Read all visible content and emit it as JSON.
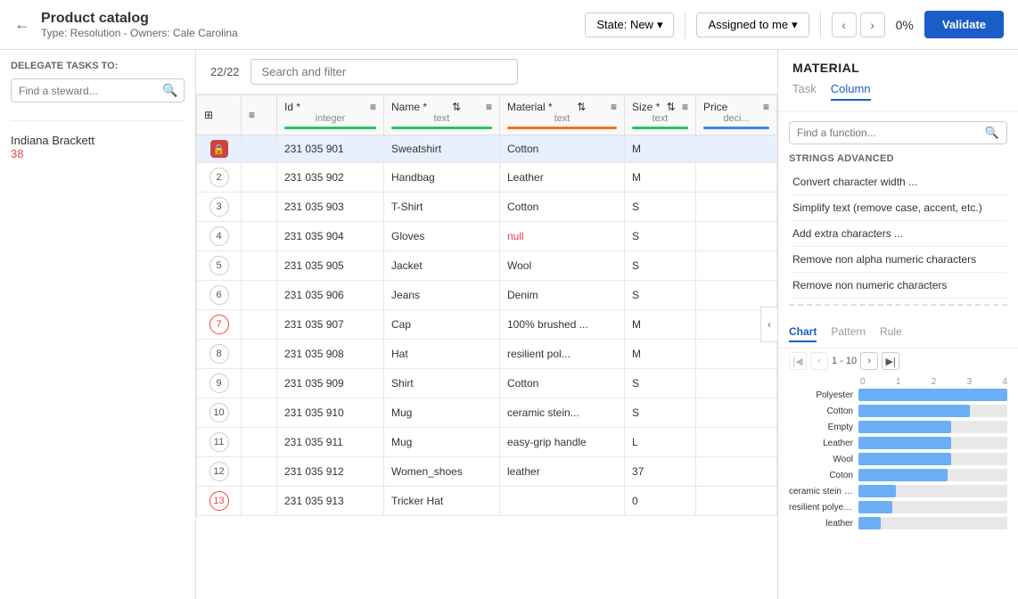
{
  "topbar": {
    "back_icon": "←",
    "title": "Product catalog",
    "subtitle": "Type: Resolution - Owners: Cale Carolina",
    "state_label": "State: New",
    "assigned_label": "Assigned to me",
    "back_arrow": "‹",
    "forward_arrow": "›",
    "percent": "0%",
    "validate_label": "Validate"
  },
  "sidebar": {
    "delegate_label": "DELEGATE TASKS TO:",
    "steward_placeholder": "Find a steward...",
    "steward_name": "Indiana Brackett",
    "steward_count": "38"
  },
  "center": {
    "record_count": "22/22",
    "search_placeholder": "Search and filter"
  },
  "table": {
    "columns": [
      {
        "id": "row",
        "name": "",
        "type": ""
      },
      {
        "id": "actions",
        "name": "≡",
        "type": ""
      },
      {
        "id": "id",
        "name": "Id *",
        "type": "integer",
        "bar": "green"
      },
      {
        "id": "name",
        "name": "Name *",
        "type": "text",
        "bar": "green"
      },
      {
        "id": "material",
        "name": "Material *",
        "type": "text",
        "bar": "orange"
      },
      {
        "id": "size",
        "name": "Size *",
        "type": "text",
        "bar": "green"
      },
      {
        "id": "price",
        "name": "Price",
        "type": "deci...",
        "bar": "blue"
      }
    ],
    "rows": [
      {
        "num": "1",
        "selected": true,
        "locked": true,
        "id": "231 035 901",
        "name": "Sweatshirt",
        "material": "Cotton",
        "size": "M",
        "price": ""
      },
      {
        "num": "2",
        "selected": false,
        "locked": false,
        "id": "231 035 902",
        "name": "Handbag",
        "material": "Leather",
        "size": "M",
        "price": ""
      },
      {
        "num": "3",
        "selected": false,
        "locked": false,
        "id": "231 035 903",
        "name": "T-Shirt",
        "material": "Cotton",
        "size": "S",
        "price": ""
      },
      {
        "num": "4",
        "selected": false,
        "locked": false,
        "id": "231 035 904",
        "name": "Gloves",
        "material": "null",
        "size": "S",
        "price": ""
      },
      {
        "num": "5",
        "selected": false,
        "locked": false,
        "id": "231 035 905",
        "name": "Jacket",
        "material": "Wool",
        "size": "S",
        "price": ""
      },
      {
        "num": "6",
        "selected": false,
        "locked": false,
        "id": "231 035 906",
        "name": "Jeans",
        "material": "Denim",
        "size": "S",
        "price": ""
      },
      {
        "num": "7",
        "selected": false,
        "locked": false,
        "id": "231 035 907",
        "name": "Cap",
        "material": "100% brushed ...",
        "size": "M",
        "price": ""
      },
      {
        "num": "8",
        "selected": false,
        "locked": false,
        "id": "231 035 908",
        "name": "Hat",
        "material": "resilient pol...",
        "size": "M",
        "price": ""
      },
      {
        "num": "9",
        "selected": false,
        "locked": false,
        "id": "231 035 909",
        "name": "Shirt",
        "material": "Cotton",
        "size": "S",
        "price": ""
      },
      {
        "num": "10",
        "selected": false,
        "locked": false,
        "id": "231 035 910",
        "name": "Mug",
        "material": "ceramic stein...",
        "size": "S",
        "price": ""
      },
      {
        "num": "11",
        "selected": false,
        "locked": false,
        "id": "231 035 911",
        "name": "Mug",
        "material": "easy-grip handle",
        "size": "L",
        "price": ""
      },
      {
        "num": "12",
        "selected": false,
        "locked": false,
        "id": "231 035 912",
        "name": "Women_shoes",
        "material": "leather",
        "size": "37",
        "price": ""
      },
      {
        "num": "13",
        "selected": false,
        "locked": false,
        "id": "231 035 913",
        "name": "Tricker Hat",
        "material": "",
        "size": "0",
        "price": ""
      }
    ]
  },
  "right_panel": {
    "section_title": "MATERIAL",
    "tabs": [
      "Task",
      "Column"
    ],
    "active_tab": "Column",
    "func_search_placeholder": "Find a function...",
    "strings_advanced_label": "STRINGS ADVANCED",
    "functions": [
      {
        "label": "Convert character width ...",
        "highlighted": false
      },
      {
        "label": "Simplify text (remove case, accent, etc.)",
        "highlighted": false
      },
      {
        "label": "Add extra characters ...",
        "highlighted": false
      },
      {
        "label": "Remove non alpha numeric characters",
        "highlighted": false
      },
      {
        "label": "Remove non numeric characters",
        "highlighted": false
      }
    ],
    "chart_tabs": [
      "Chart",
      "Pattern",
      "Rule"
    ],
    "active_chart_tab": "Chart",
    "pagination": "1 - 10",
    "chart_axis_labels": [
      "0",
      "1",
      "2",
      "3",
      "4"
    ],
    "chart_bars": [
      {
        "label": "Polyester",
        "value": 4,
        "max": 4
      },
      {
        "label": "Cotton",
        "value": 3,
        "max": 4
      },
      {
        "label": "Empty",
        "value": 2.5,
        "max": 4
      },
      {
        "label": "Leather",
        "value": 2.5,
        "max": 4
      },
      {
        "label": "Wool",
        "value": 2.5,
        "max": 4
      },
      {
        "label": "Coton",
        "value": 2.4,
        "max": 4
      },
      {
        "label": "ceramic stein with gold trim",
        "value": 1,
        "max": 4
      },
      {
        "label": "resilient polyester",
        "value": 0.9,
        "max": 4
      },
      {
        "label": "leather",
        "value": 0.6,
        "max": 4
      }
    ]
  }
}
